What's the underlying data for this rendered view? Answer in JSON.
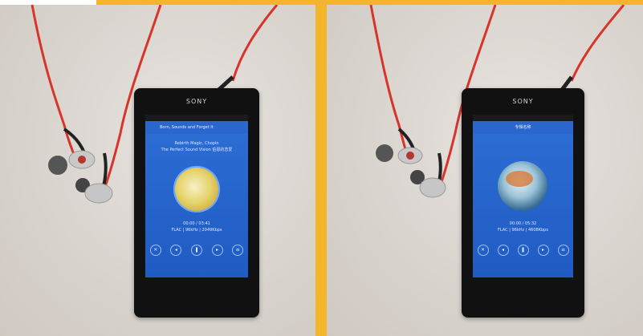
{
  "photos": [
    {
      "phone": {
        "brand": "SONY",
        "screen_title": "Born, Sounds and Forget It",
        "track_line1": "Rebirth Magic, Chopin",
        "track_line2": "The Perfect Sound Vision 伯恩的恋爱",
        "album_art": "yellow-map-album-art",
        "meta_line1": "00:00 / 03:41",
        "meta_line2": "FLAC | 96kHz | 2049Kbps",
        "nav_icons": [
          "back-icon",
          "home-icon",
          "recent-apps-icon"
        ]
      },
      "accent": "#f3b52a"
    },
    {
      "phone": {
        "brand": "SONY",
        "screen_title": "专辑名称",
        "album_art": "blue-wave-album-art",
        "meta_line1": "00:00 / 05:32",
        "meta_line2": "FLAC | 96kHz | 4608Kbps",
        "nav_icons": [
          "back-icon",
          "home-icon",
          "recent-apps-icon"
        ]
      },
      "accent": "#f3b52a"
    }
  ]
}
